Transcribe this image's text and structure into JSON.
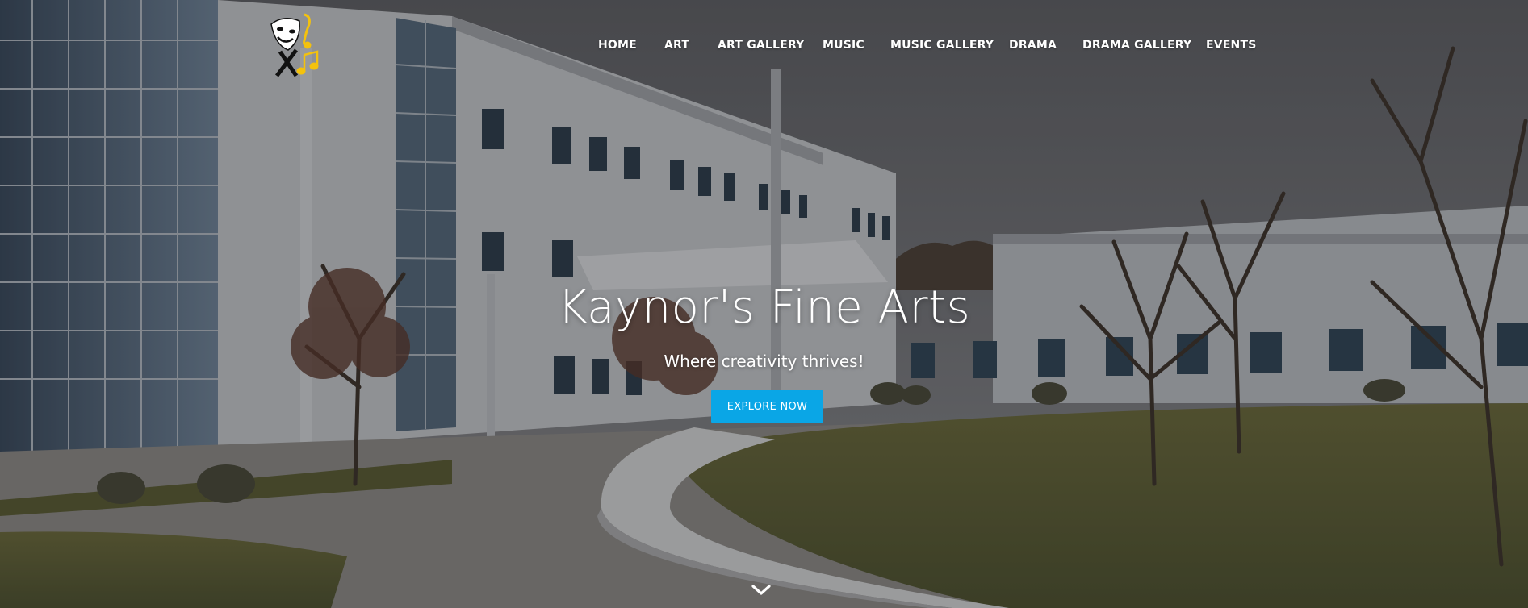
{
  "site": {
    "logo_icon": "theater-masks-music-notes-logo",
    "colors": {
      "accent": "#0aa6e6",
      "logo_gold": "#f4c20d"
    }
  },
  "nav": {
    "items": [
      {
        "label": "HOME"
      },
      {
        "label": "ART"
      },
      {
        "label": "ART GALLERY"
      },
      {
        "label": "MUSIC"
      },
      {
        "label": "MUSIC GALLERY"
      },
      {
        "label": "DRAMA"
      },
      {
        "label": "DRAMA GALLERY"
      },
      {
        "label": "EVENTS"
      }
    ]
  },
  "hero": {
    "title": "Kaynor's Fine Arts",
    "subtitle": "Where creativity thrives!",
    "cta_label": "EXPLORE NOW",
    "scroll_icon": "chevron-down-icon",
    "background": "school-building-photo"
  }
}
